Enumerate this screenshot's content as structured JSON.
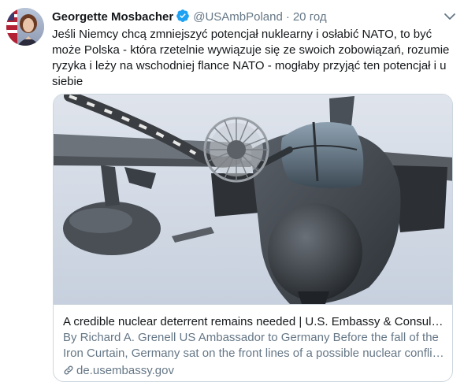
{
  "tweet": {
    "author_name": "Georgette Mosbacher",
    "handle": "@USAmbPoland",
    "separator": "·",
    "time": "20 год",
    "text": "Jeśli Niemcy chcą zmniejszyć potencjał nuklearny i osłabić NATO, to być może Polska - która rzetelnie wywiązuje się ze swoich zobowiązań, rozumie ryzyka i leży na wschodniej flance NATO - mogłaby przyjąć ten potencjał i u siebie"
  },
  "card": {
    "title": "A credible nuclear deterrent remains needed | U.S. Embassy & Consulat...",
    "description_line1": "By Richard A. Grenell US Ambassador to Germany   Before the fall of the",
    "description_line2": "Iron Curtain, Germany sat on the front lines of a possible nuclear conflic...",
    "domain": "de.usembassy.gov"
  },
  "colors": {
    "verified_badge": "#1da1f2",
    "secondary_text": "#657786",
    "border": "#ccd6dd"
  },
  "icons": {
    "verified": "verified-badge-icon",
    "caret": "chevron-down-icon",
    "link": "link-icon"
  }
}
